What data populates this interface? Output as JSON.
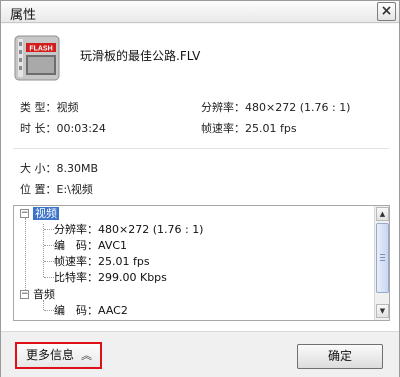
{
  "window": {
    "title": "属性",
    "close_glyph": "×"
  },
  "file": {
    "name": "玩滑板的最佳公路.FLV",
    "icon_label": "FLASH"
  },
  "summary": {
    "type_label": "类 型：",
    "type_value": "视频",
    "duration_label": "时 长：",
    "duration_value": "00:03:24",
    "resolution_label": "分辨率：",
    "resolution_value": "480×272 (1.76 : 1)",
    "framerate_label": "帧速率：",
    "framerate_value": "25.01 fps",
    "size_label": "大 小：",
    "size_value": "8.30MB",
    "location_label": "位 置：",
    "location_value": "E:\\视频"
  },
  "details": {
    "video_group": {
      "label": "视频",
      "expander": "−"
    },
    "video_rows": [
      {
        "label": "分辨率：",
        "value": "480×272 (1.76 : 1)"
      },
      {
        "label": "编　码：",
        "value": "AVC1"
      },
      {
        "label": "帧速率：",
        "value": "25.01 fps"
      },
      {
        "label": "比特率：",
        "value": "299.00 Kbps"
      }
    ],
    "audio_group": {
      "label": "音频",
      "expander": "−"
    },
    "audio_rows": [
      {
        "label": "编　码：",
        "value": "AAC2"
      }
    ],
    "scroll_up": "▲",
    "scroll_down": "▼"
  },
  "footer": {
    "more_info_label": "更多信息",
    "more_info_chevron": "︽",
    "ok_label": "确定"
  },
  "colors": {
    "highlight": "#e0101a",
    "selection": "#3b73c9",
    "flash_badge": "#d11f1f"
  }
}
